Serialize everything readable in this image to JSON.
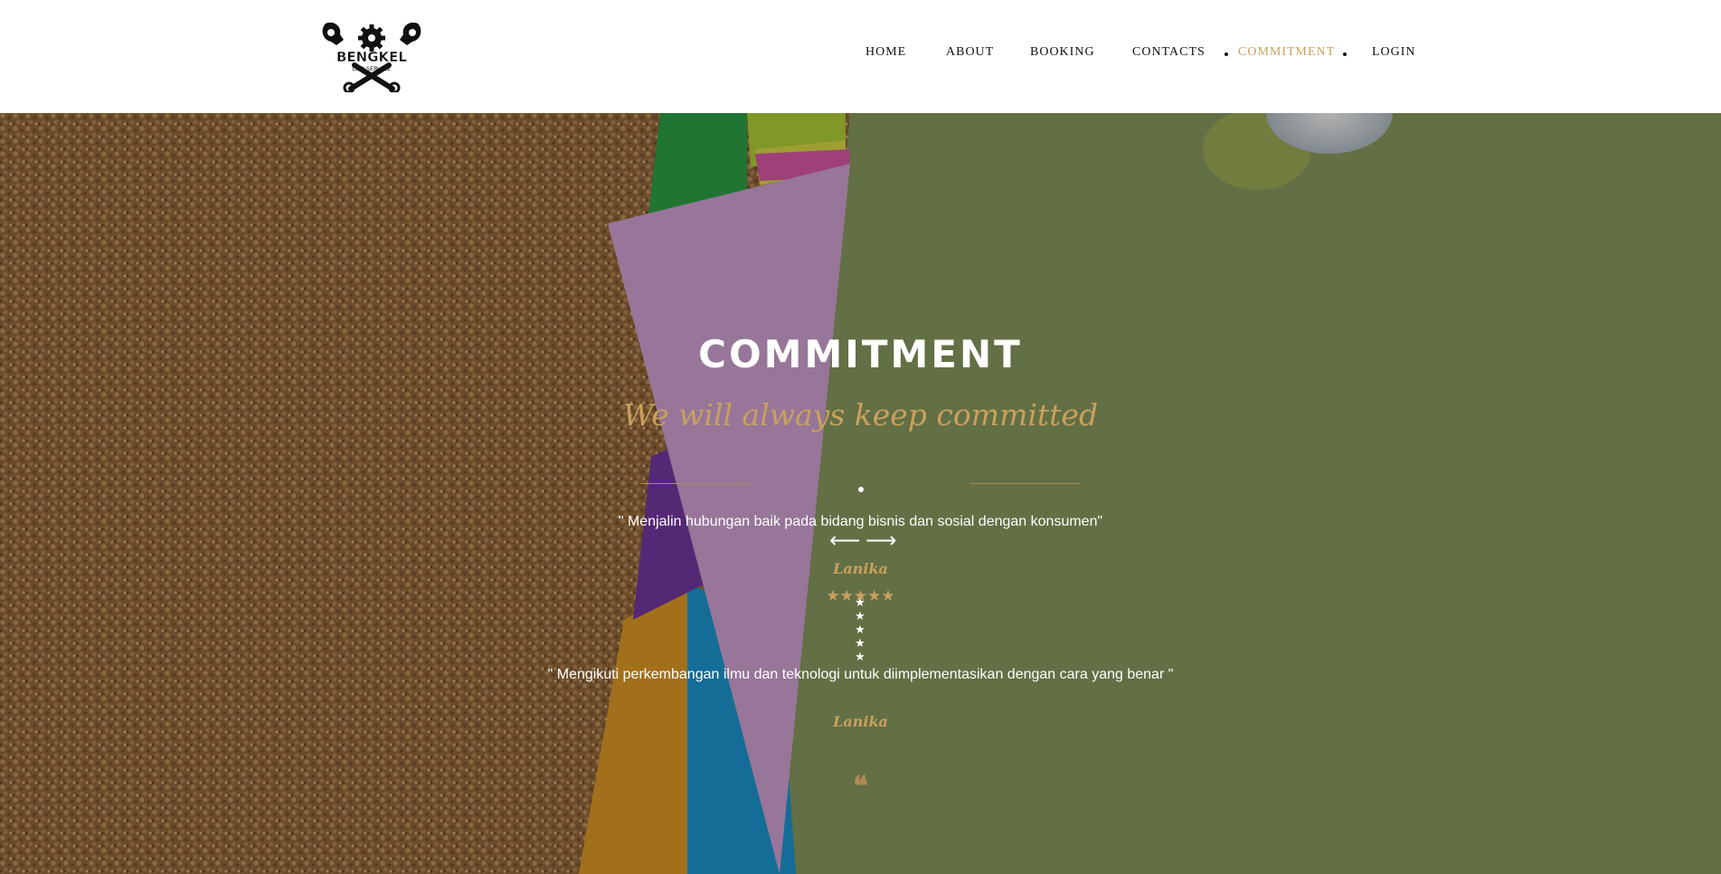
{
  "header": {
    "logo_text": "BENGKEL",
    "logo_subtext": "LAN SERVICE",
    "nav": [
      {
        "label": "HOME"
      },
      {
        "label": "ABOUT"
      },
      {
        "label": "BOOKING"
      },
      {
        "label": "CONTACTS"
      },
      {
        "label": "COMMITMENT"
      },
      {
        "label": "LOGIN"
      }
    ],
    "active_item": "COMMITMENT"
  },
  "hero": {
    "title": "COMMITMENT",
    "subtitle": "We will always keep committed",
    "prev_icon": "arrow-left-icon",
    "next_icon": "arrow-right-icon",
    "testimonials": [
      {
        "rating": 5,
        "quote": "\" Menjalin hubungan baik pada bidang bisnis dan sosial dengan konsumen\"",
        "author": "Lanika"
      },
      {
        "rating": 5,
        "quote": "\" Mengikuti perkembangan ilmu dan teknologi untuk diimplementasikan dengan cara yang benar \"",
        "author": "Lanika"
      }
    ],
    "quote_icon": "quote-icon"
  },
  "colors": {
    "accent": "#c9a15e",
    "nav_text": "#111111",
    "hero_text": "#ffffff"
  }
}
